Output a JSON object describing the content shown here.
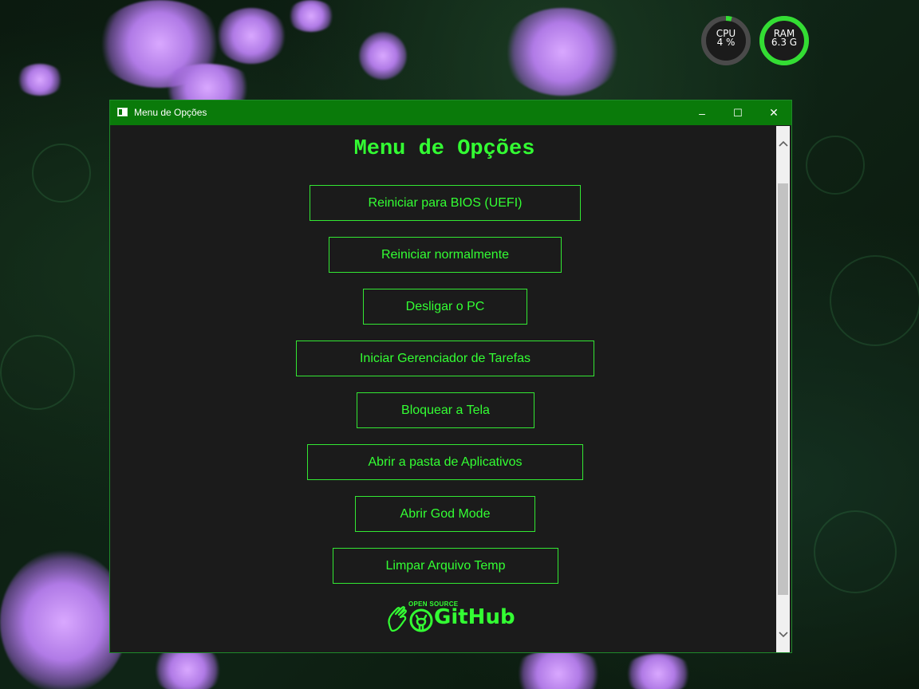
{
  "desktop": {
    "widgets": {
      "cpu": {
        "label": "CPU",
        "value": "4 %",
        "percent": 4,
        "color": "#33dd33"
      },
      "ram": {
        "label": "RAM",
        "value": "6.3 G",
        "percent": 100,
        "color": "#33dd33"
      }
    }
  },
  "window": {
    "title": "Menu de Opções",
    "controls": {
      "minimize": "–",
      "maximize": "☐",
      "close": "✕"
    },
    "heading": "Menu de Opções",
    "buttons": [
      {
        "label": "Reiniciar para BIOS (UEFI)"
      },
      {
        "label": "Reiniciar normalmente"
      },
      {
        "label": "Desligar o PC"
      },
      {
        "label": "Iniciar Gerenciador de Tarefas"
      },
      {
        "label": "Bloquear a Tela"
      },
      {
        "label": "Abrir a pasta de Aplicativos"
      },
      {
        "label": "Abrir God Mode"
      },
      {
        "label": "Limpar Arquivo Temp"
      }
    ],
    "logo": {
      "small": "OPEN SOURCE",
      "big": "GitHub"
    },
    "accent": "#33ff33",
    "titlebar_color": "#0a7a0a"
  }
}
